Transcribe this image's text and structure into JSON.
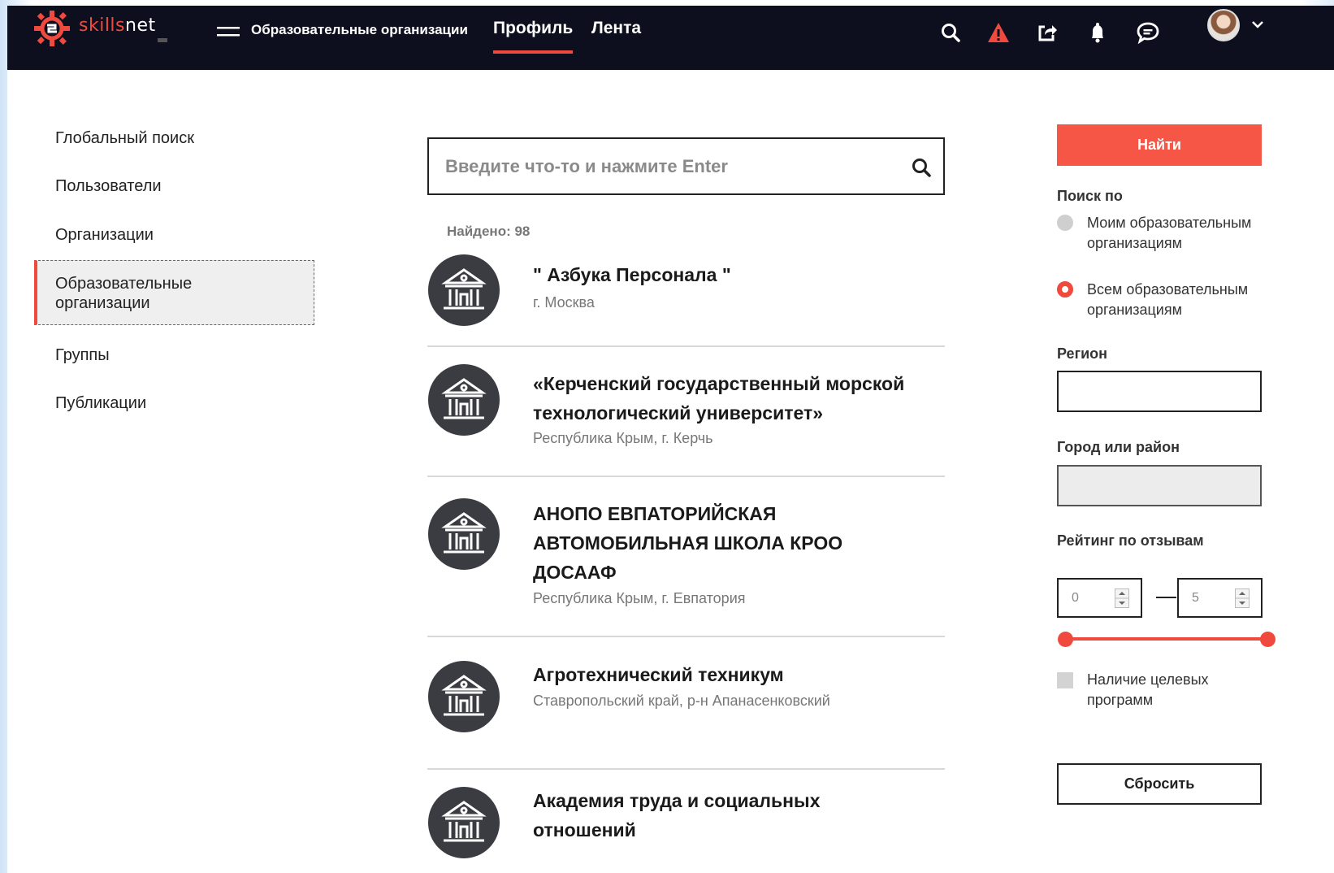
{
  "header": {
    "logo_text_a": "skills",
    "logo_text_b": "net",
    "nav": {
      "org_label": "Образовательные организации",
      "profile_label": "Профиль",
      "feed_label": "Лента"
    },
    "accent_color": "#f04a3e",
    "icons": [
      "search-icon",
      "warning-icon",
      "share-icon",
      "bell-icon",
      "chat-icon",
      "chevron-down-icon"
    ]
  },
  "sidebar": {
    "items": [
      {
        "label": "Глобальный поиск"
      },
      {
        "label": "Пользователи"
      },
      {
        "label": "Организации"
      },
      {
        "label": "Образовательные организации",
        "active": true
      },
      {
        "label": "Группы"
      },
      {
        "label": "Публикации"
      }
    ]
  },
  "search": {
    "placeholder": "Введите что-то и нажмите Enter",
    "value": "",
    "found_text": "Найдено: 98"
  },
  "results": [
    {
      "name": "\" Азбука Персонала \"",
      "location": "г. Москва"
    },
    {
      "name": "«Керченский государственный морской технологический университет»",
      "location": "Республика Крым, г. Керчь"
    },
    {
      "name": "АНОПО ЕВПАТОРИЙСКАЯ АВТОМОБИЛЬНАЯ ШКОЛА КРОО ДОСААФ",
      "location": "Республика Крым, г. Евпатория"
    },
    {
      "name": "Агротехнический техникум",
      "location": "Ставропольский край, р-н Апанасенковский"
    },
    {
      "name": "Академия труда и социальных отношений",
      "location": ""
    }
  ],
  "filters": {
    "find_label": "Найти",
    "search_by_label": "Поиск по",
    "options": [
      {
        "label": "Моим образовательным организациям",
        "selected": false
      },
      {
        "label": "Всем образовательным организациям",
        "selected": true
      }
    ],
    "region_label": "Регион",
    "region_value": "",
    "city_label": "Город или район",
    "city_value": "",
    "rating_label": "Рейтинг по отзывам",
    "rating_min": "0",
    "rating_max": "5",
    "target_programs_label": "Наличие целевых программ",
    "target_programs_checked": false,
    "reset_label": "Сбросить"
  }
}
